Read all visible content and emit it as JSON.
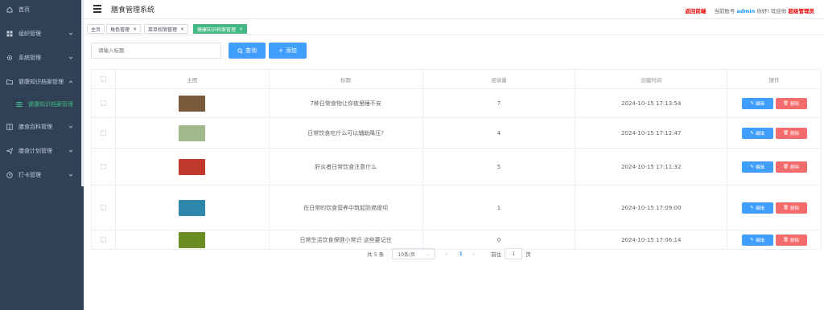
{
  "app": {
    "title": "膳食管理系统"
  },
  "header": {
    "back_link": "返回前端",
    "account_prefix": "当前账号",
    "username": "admin",
    "greeting": "你好! 欢迎你",
    "role": "超级管理员"
  },
  "sidebar": {
    "items": [
      {
        "label": "首页",
        "icon": "home-icon"
      },
      {
        "label": "组织管理",
        "icon": "grid-icon"
      },
      {
        "label": "系统管理",
        "icon": "gear-icon"
      },
      {
        "label": "健康知识档案管理",
        "icon": "folder-icon"
      },
      {
        "label": "健康知识档案管理",
        "icon": "list-icon"
      },
      {
        "label": "膳食百科管理",
        "icon": "book-icon"
      },
      {
        "label": "膳食计划管理",
        "icon": "send-icon"
      },
      {
        "label": "打卡管理",
        "icon": "clock-icon"
      }
    ]
  },
  "tags": [
    {
      "label": "主页"
    },
    {
      "label": "角色管理"
    },
    {
      "label": "菜单权限管理"
    },
    {
      "label": "健康知识档案管理"
    }
  ],
  "search": {
    "placeholder": "请输入标题",
    "query_label": "查询",
    "add_label": "添加"
  },
  "table": {
    "columns": [
      "主图",
      "标题",
      "阅读量",
      "创建时间",
      "操作"
    ],
    "rows": [
      {
        "title": "7种日常食物让你夜里睡不安",
        "views": "7",
        "created": "2024-10-15 17:13:54",
        "thumb_color": "#7a5a3c"
      },
      {
        "title": "日常饮食吃什么可以辅助降压?",
        "views": "4",
        "created": "2024-10-15 17:12:47",
        "thumb_color": "#9fb98a"
      },
      {
        "title": "肝炎者日常饮食注意什么",
        "views": "5",
        "created": "2024-10-15 17:11:32",
        "thumb_color": "#c0392b"
      },
      {
        "title": "在日常的饮食营养中筑起防癌堤坝",
        "views": "1",
        "created": "2024-10-15 17:09:00",
        "thumb_color": "#2e86ab"
      },
      {
        "title": "日常生活饮食保健小常识 这些要记住",
        "views": "0",
        "created": "2024-10-15 17:06:14",
        "thumb_color": "#6b8e23"
      }
    ],
    "edit_label": "编辑",
    "delete_label": "删除"
  },
  "pagination": {
    "total_text": "共 5 条",
    "page_size": "10条/页",
    "current_page": "1",
    "goto_label": "前往",
    "goto_value": "1",
    "unit": "页"
  },
  "colors": {
    "sidebar_bg": "#304156",
    "primary": "#409eff",
    "danger": "#f56c6c",
    "active_tag": "#42b983"
  }
}
